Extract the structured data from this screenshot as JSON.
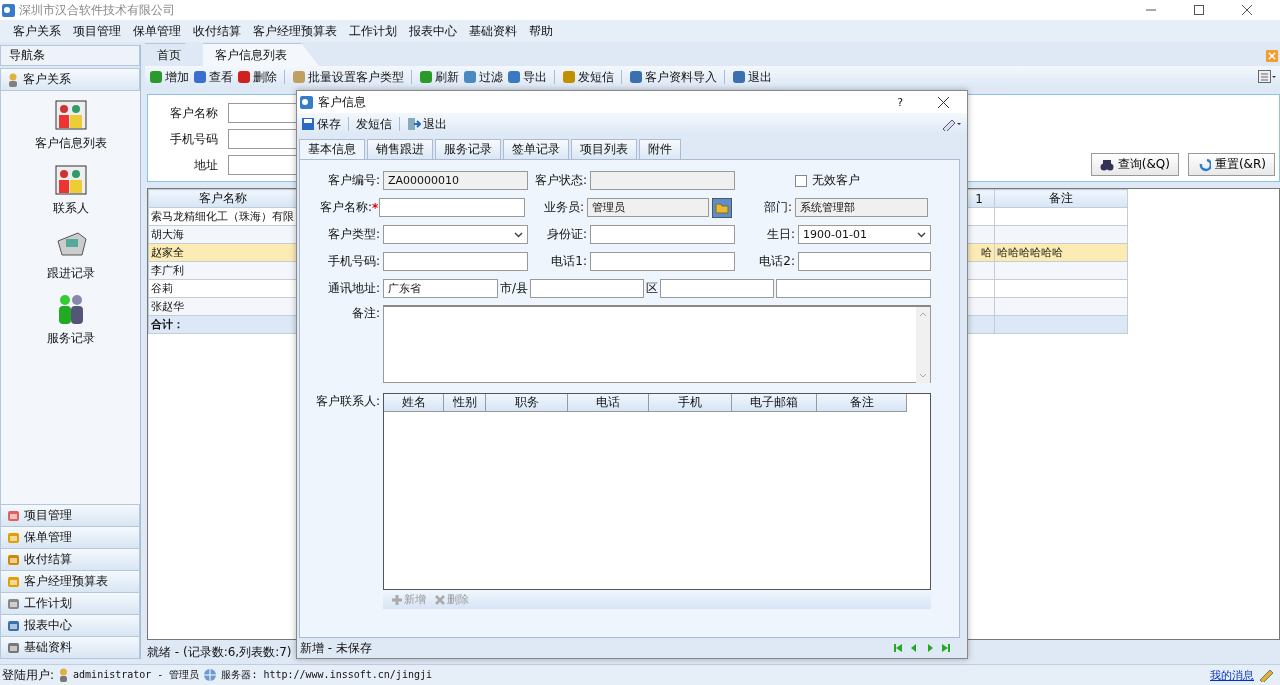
{
  "window": {
    "title": "深圳市汉合软件技术有限公司"
  },
  "menu": [
    "客户关系",
    "项目管理",
    "保单管理",
    "收付结算",
    "客户经理预算表",
    "工作计划",
    "报表中心",
    "基础资料",
    "帮助"
  ],
  "nav": {
    "title": "导航条",
    "active_group": "客户关系",
    "items": [
      {
        "label": "客户信息列表"
      },
      {
        "label": "联系人"
      },
      {
        "label": "跟进记录"
      },
      {
        "label": "服务记录"
      }
    ],
    "groups": [
      "项目管理",
      "保单管理",
      "收付结算",
      "客户经理预算表",
      "工作计划",
      "报表中心",
      "基础资料"
    ]
  },
  "tabs": [
    {
      "label": "首页",
      "selected": false
    },
    {
      "label": "客户信息列表",
      "selected": true
    }
  ],
  "toolbar": [
    "增加",
    "查看",
    "删除",
    "批量设置客户类型",
    "刷新",
    "过滤",
    "导出",
    "发短信",
    "客户资料导入",
    "退出"
  ],
  "search": {
    "fields": [
      "客户名称",
      "手机号码",
      "地址"
    ],
    "buttons": [
      "查询(&Q)",
      "重置(&R)"
    ]
  },
  "grid": {
    "columns": [
      "客户名称",
      "1",
      "备注"
    ],
    "rows": [
      {
        "name": "索马龙精细化工（珠海）有限",
        "selected": false
      },
      {
        "name": "胡大海",
        "selected": false
      },
      {
        "name": "赵家全",
        "column_2": "哈",
        "remark": "哈哈哈哈哈哈",
        "selected": true
      },
      {
        "name": "李广利",
        "selected": false
      },
      {
        "name": "谷莉",
        "selected": false
      },
      {
        "name": "张赵华",
        "selected": false
      }
    ],
    "total_label": "合计："
  },
  "status": "就绪 - (记录数:6,列表数:7)",
  "status_bar": {
    "user_label": "登陆用户:",
    "user": "administrator - 管理员",
    "server": "服务器: http://www.inssoft.cn/jingji",
    "messages": "我的消息"
  },
  "dialog": {
    "title": "客户信息",
    "help": "?",
    "toolbar": [
      "保存",
      "发短信",
      "退出"
    ],
    "tabs": [
      {
        "label": "基本信息",
        "selected": true
      },
      {
        "label": "销售跟进",
        "selected": false
      },
      {
        "label": "服务记录",
        "selected": false
      },
      {
        "label": "签单记录",
        "selected": false
      },
      {
        "label": "项目列表",
        "selected": false
      },
      {
        "label": "附件",
        "selected": false
      }
    ],
    "form": [
      [
        {
          "label": "客户编号:",
          "kind": "text",
          "readonly": true,
          "value": "ZA00000010"
        },
        {
          "label": "客户状态:",
          "kind": "text",
          "readonly": true
        },
        {
          "kind": "checkbox",
          "label": "无效客户",
          "checked": false
        }
      ],
      [
        {
          "label": "客户名称:",
          "kind": "text",
          "readonly": false,
          "required_mark": "*"
        },
        {
          "label": "业务员:",
          "kind": "picker",
          "readonly": true,
          "value": "管理员"
        },
        {
          "label": "部门:",
          "kind": "text",
          "readonly": true,
          "value": "系统管理部"
        }
      ],
      [
        {
          "label": "客户类型:",
          "kind": "select",
          "readonly": false
        },
        {
          "label": "身份证:",
          "kind": "text",
          "readonly": false
        },
        {
          "label": "生日:",
          "kind": "select",
          "readonly": false,
          "value": "1900-01-01"
        }
      ],
      [
        {
          "label": "手机号码:",
          "kind": "text",
          "readonly": false
        },
        {
          "label": "电话1:",
          "kind": "text",
          "readonly": false
        },
        {
          "label": "电话2:",
          "kind": "text",
          "readonly": false
        }
      ]
    ],
    "address": {
      "label": "通讯地址:",
      "province": "广东省",
      "city_label": "市/县",
      "district_label": "区"
    },
    "remark_label": "备注:",
    "contacts": {
      "label": "客户联系人:",
      "columns": [
        "姓名",
        "性别",
        "职务",
        "电话",
        "手机",
        "电子邮箱",
        "备注"
      ]
    },
    "contact_toolbar": [
      {
        "label": "新增",
        "disabled": true
      },
      {
        "label": "删除",
        "disabled": true
      }
    ],
    "footer": "新增 - 未保存"
  }
}
